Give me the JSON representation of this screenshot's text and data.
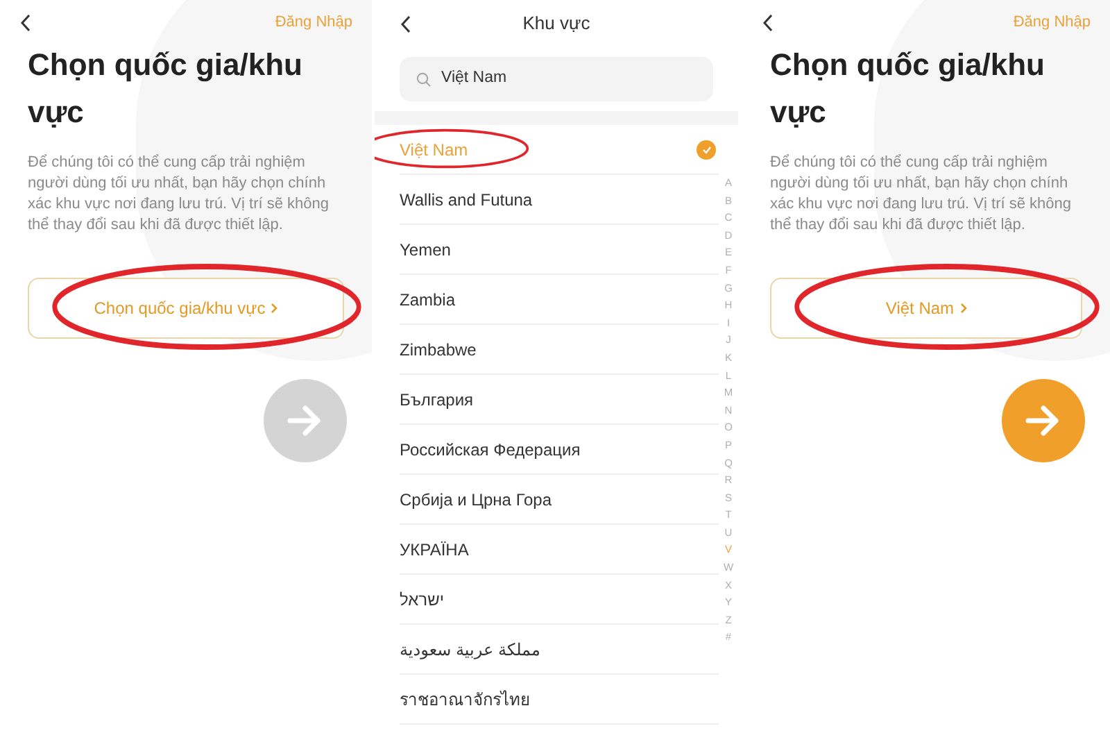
{
  "screens": [
    {
      "kind": "intro",
      "login": "Đăng Nhập",
      "title": "Chọn quốc gia/khu vực",
      "description": "Để chúng tôi có thể cung cấp trải nghiệm người dùng tối ưu nhất, bạn hãy chọn chính xác khu vực nơi đang lưu trú. Vị trí sẽ không thể thay đổi sau khi đã được thiết lập.",
      "region_button": {
        "label": "Chọn quốc gia/khu vực",
        "circled": true
      },
      "next_button": {
        "enabled": false
      }
    },
    {
      "kind": "list",
      "title": "Khu vực",
      "search": {
        "value": "Việt Nam"
      },
      "countries": [
        {
          "name": "Việt Nam",
          "selected": true,
          "circled": true
        },
        {
          "name": "Wallis and Futuna",
          "selected": false,
          "circled": false
        },
        {
          "name": "Yemen",
          "selected": false,
          "circled": false
        },
        {
          "name": "Zambia",
          "selected": false,
          "circled": false
        },
        {
          "name": "Zimbabwe",
          "selected": false,
          "circled": false
        },
        {
          "name": "България",
          "selected": false,
          "circled": false
        },
        {
          "name": "Российская Федерация",
          "selected": false,
          "circled": false
        },
        {
          "name": "Србија и Црна Гора",
          "selected": false,
          "circled": false
        },
        {
          "name": "УКРАЇНА",
          "selected": false,
          "circled": false
        },
        {
          "name": "ישראל",
          "selected": false,
          "circled": false
        },
        {
          "name": "مملكة عربية سعودية",
          "selected": false,
          "circled": false
        },
        {
          "name": "ราชอาณาจักรไทย",
          "selected": false,
          "circled": false
        }
      ],
      "index": [
        {
          "letter": "A",
          "selected": false
        },
        {
          "letter": "B",
          "selected": false
        },
        {
          "letter": "C",
          "selected": false
        },
        {
          "letter": "D",
          "selected": false
        },
        {
          "letter": "E",
          "selected": false
        },
        {
          "letter": "F",
          "selected": false
        },
        {
          "letter": "G",
          "selected": false
        },
        {
          "letter": "H",
          "selected": false
        },
        {
          "letter": "I",
          "selected": false
        },
        {
          "letter": "J",
          "selected": false
        },
        {
          "letter": "K",
          "selected": false
        },
        {
          "letter": "L",
          "selected": false
        },
        {
          "letter": "M",
          "selected": false
        },
        {
          "letter": "N",
          "selected": false
        },
        {
          "letter": "O",
          "selected": false
        },
        {
          "letter": "P",
          "selected": false
        },
        {
          "letter": "Q",
          "selected": false
        },
        {
          "letter": "R",
          "selected": false
        },
        {
          "letter": "S",
          "selected": false
        },
        {
          "letter": "T",
          "selected": false
        },
        {
          "letter": "U",
          "selected": false
        },
        {
          "letter": "V",
          "selected": true
        },
        {
          "letter": "W",
          "selected": false
        },
        {
          "letter": "X",
          "selected": false
        },
        {
          "letter": "Y",
          "selected": false
        },
        {
          "letter": "Z",
          "selected": false
        },
        {
          "letter": "#",
          "selected": false
        }
      ]
    },
    {
      "kind": "intro",
      "login": "Đăng Nhập",
      "title": "Chọn quốc gia/khu vực",
      "description": "Để chúng tôi có thể cung cấp trải nghiệm người dùng tối ưu nhất, bạn hãy chọn chính xác khu vực nơi đang lưu trú. Vị trí sẽ không thể thay đổi sau khi đã được thiết lập.",
      "region_button": {
        "label": "Việt Nam",
        "circled": true
      },
      "next_button": {
        "enabled": true
      }
    }
  ]
}
